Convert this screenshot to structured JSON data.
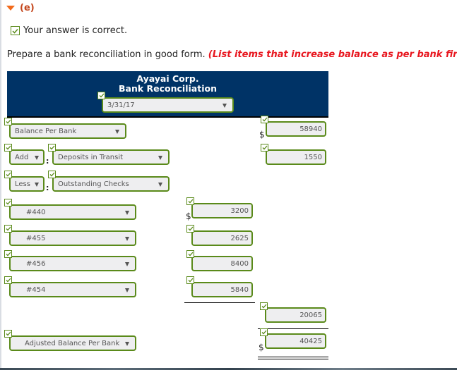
{
  "section": {
    "label": "(e)",
    "icon": "collapse-triangle-icon"
  },
  "status": {
    "text": "Your answer is correct.",
    "icon": "check-icon"
  },
  "instructions": {
    "text": "Prepare a bank reconciliation in good form.",
    "emphasis": "(List items that increase balance as per bank first.)"
  },
  "statement": {
    "company": "Ayayai Corp.",
    "title": "Bank Reconciliation",
    "date": "3/31/17"
  },
  "rows": {
    "balance_per_bank": {
      "label": "Balance Per Bank",
      "currency": "$",
      "amount": "58940"
    },
    "add": {
      "operator": "Add",
      "item": "Deposits in Transit",
      "amount": "1550"
    },
    "less": {
      "operator": "Less",
      "item": "Outstanding Checks"
    },
    "checks": [
      {
        "label": "#440",
        "amount": "3200",
        "currency": "$"
      },
      {
        "label": "#455",
        "amount": "2625"
      },
      {
        "label": "#456",
        "amount": "8400"
      },
      {
        "label": "#454",
        "amount": "5840"
      }
    ],
    "checks_total": "20065",
    "adjusted": {
      "label": "Adjusted Balance Per Bank",
      "currency": "$",
      "amount": "40425"
    }
  },
  "colors": {
    "accent_green": "#5a8a1a",
    "banner": "#003366",
    "emphasis_red": "#e8171f",
    "section_orange": "#c4461c"
  }
}
